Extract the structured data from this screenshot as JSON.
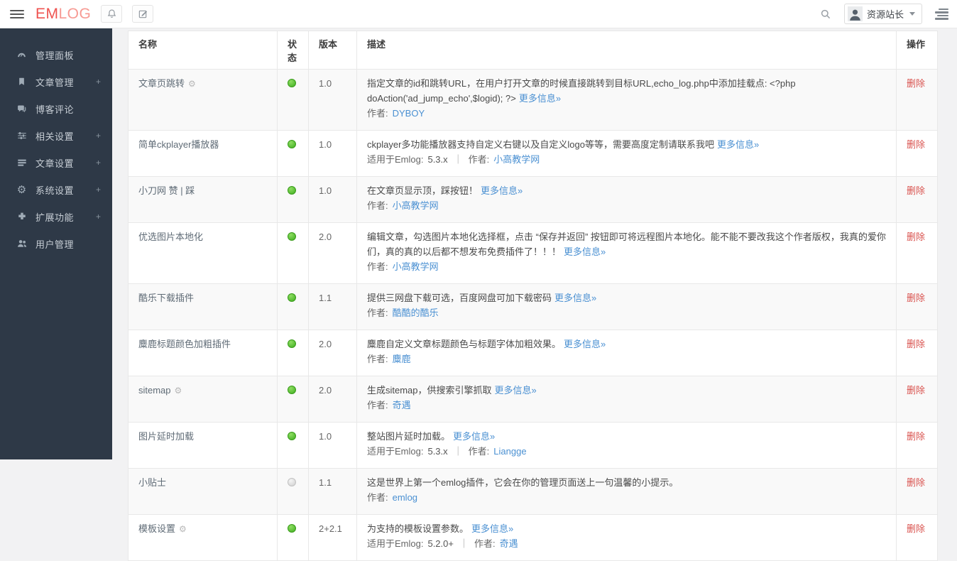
{
  "topbar": {
    "logo_em": "EM",
    "logo_log": "LOG",
    "username": "资源站长"
  },
  "sidebar": {
    "expand_symbol": "+",
    "items": [
      {
        "label": "管理面板",
        "icon": "dashboard-icon",
        "expandable": false
      },
      {
        "label": "文章管理",
        "icon": "bookmark-icon",
        "expandable": true
      },
      {
        "label": "博客评论",
        "icon": "comments-icon",
        "expandable": false
      },
      {
        "label": "相关设置",
        "icon": "sliders-icon",
        "expandable": true
      },
      {
        "label": "文章设置",
        "icon": "list-icon",
        "expandable": true
      },
      {
        "label": "系统设置",
        "icon": "gear-icon",
        "expandable": true
      },
      {
        "label": "扩展功能",
        "icon": "puzzle-icon",
        "expandable": true
      },
      {
        "label": "用户管理",
        "icon": "users-icon",
        "expandable": false
      }
    ]
  },
  "table": {
    "headers": {
      "name": "名称",
      "status": "状态",
      "version": "版本",
      "description": "描述",
      "action": "操作"
    },
    "more_info": "更多信息»",
    "delete": "删除",
    "author_label": "作者:",
    "compat_label": "适用于Emlog:",
    "divider": "｜",
    "gear_glyph": "⚙",
    "rows": [
      {
        "name": "文章页跳转",
        "gear": true,
        "status": "on",
        "version": "1.0",
        "desc": "指定文章的id和跳转URL，在用户打开文章的时候直接跳转到目标URL,echo_log.php中添加挂载点: <?php doAction('ad_jump_echo',$logid); ?>",
        "more": true,
        "author": "DYBOY"
      },
      {
        "name": "简单ckplayer播放器",
        "gear": false,
        "status": "on",
        "version": "1.0",
        "desc": "ckplayer多功能播放器支持自定义右键以及自定义logo等等，需要高度定制请联系我吧",
        "more": true,
        "compat": "5.3.x",
        "author": "小高教学网"
      },
      {
        "name": "小刀网 赞 | 踩",
        "gear": false,
        "status": "on",
        "version": "1.0",
        "desc": "在文章页显示顶，踩按钮！",
        "more": true,
        "author": "小高教学网"
      },
      {
        "name": "优选图片本地化",
        "gear": false,
        "status": "on",
        "version": "2.0",
        "desc": "编辑文章，勾选图片本地化选择框，点击 “保存并返回” 按钮即可将远程图片本地化。能不能不要改我这个作者版权，我真的爱你们，真的真的以后都不想发布免费插件了！！！",
        "more": true,
        "author": "小高教学网"
      },
      {
        "name": "酷乐下载插件",
        "gear": false,
        "status": "on",
        "version": "1.1",
        "desc": "提供三网盘下载可选，百度网盘可加下载密码",
        "more": true,
        "author": "酷酷的酷乐"
      },
      {
        "name": "麋鹿标题颜色加粗插件",
        "gear": false,
        "status": "on",
        "version": "2.0",
        "desc": "麋鹿自定义文章标题颜色与标题字体加粗效果。",
        "more": true,
        "author": "麋鹿"
      },
      {
        "name": "sitemap",
        "gear": true,
        "status": "on",
        "version": "2.0",
        "desc": "生成sitemap，供搜索引擎抓取",
        "more": true,
        "author": "奇遇"
      },
      {
        "name": "图片延时加载",
        "gear": false,
        "status": "on",
        "version": "1.0",
        "desc": "整站图片延时加载。",
        "more": true,
        "compat": "5.3.x",
        "author": "Liangge"
      },
      {
        "name": "小贴士",
        "gear": false,
        "status": "off",
        "version": "1.1",
        "desc": "这是世界上第一个emlog插件，它会在你的管理页面送上一句温馨的小提示。",
        "more": false,
        "author": "emlog"
      },
      {
        "name": "模板设置",
        "gear": true,
        "status": "on",
        "version": "2+2.1",
        "desc": "为支持的模板设置参数。",
        "more": true,
        "compat": "5.2.0+",
        "author": "奇遇"
      }
    ]
  },
  "colors": {
    "brand_red": "#ef5350",
    "link_blue": "#4a90d2",
    "delete_red": "#d9534f",
    "status_on_green": "#4cb71f",
    "status_off_gray": "#d5d5d5",
    "sidebar_bg": "#2e3947"
  },
  "icons": {
    "menu-icon": "three bars",
    "bell-icon": "bell outline",
    "edit-icon": "pencil on square",
    "search-icon": "magnifier",
    "user-avatar-icon": "person silhouette",
    "caret-down-icon": "▾",
    "list-toggle-icon": "stacked bars",
    "plugin-settings-icon": "⚙"
  }
}
